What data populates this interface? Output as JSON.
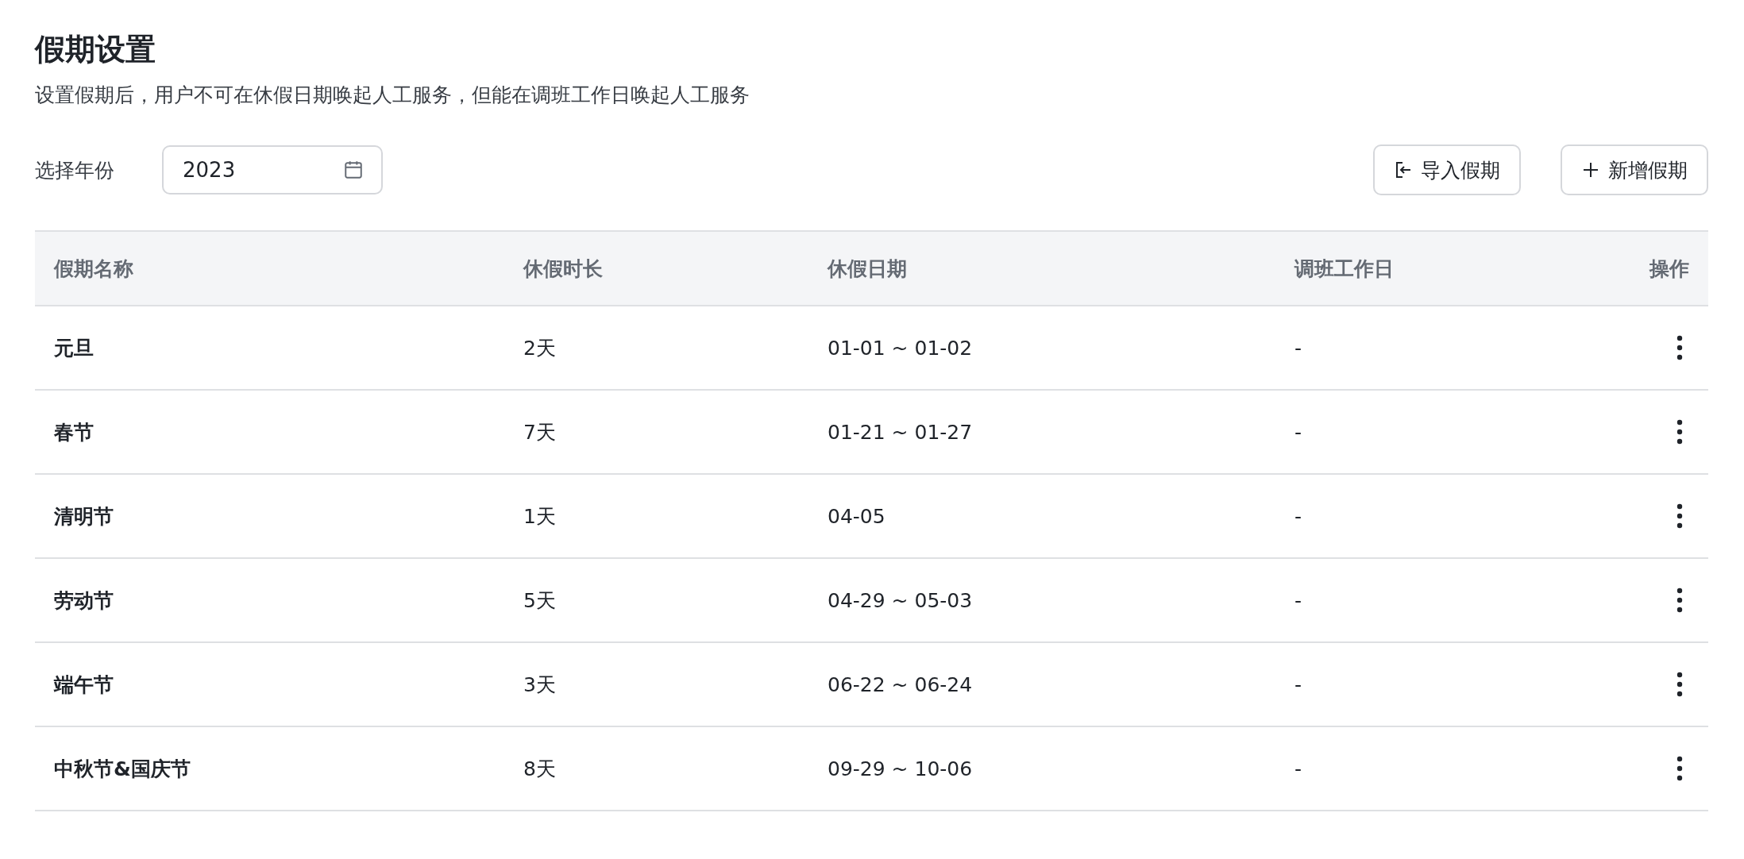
{
  "title": "假期设置",
  "description": "设置假期后，用户不可在休假日期唤起人工服务，但能在调班工作日唤起人工服务",
  "year_picker": {
    "label": "选择年份",
    "value": "2023"
  },
  "actions": [
    {
      "kind": "import",
      "label": "导入假期"
    },
    {
      "kind": "add",
      "label": "新增假期"
    }
  ],
  "table": {
    "columns": [
      "假期名称",
      "休假时长",
      "休假日期",
      "调班工作日",
      "操作"
    ],
    "rows": [
      {
        "name": "元旦",
        "duration": "2天",
        "dates": "01-01 ~ 01-02",
        "workdays": "-"
      },
      {
        "name": "春节",
        "duration": "7天",
        "dates": "01-21 ~ 01-27",
        "workdays": "-"
      },
      {
        "name": "清明节",
        "duration": "1天",
        "dates": "04-05",
        "workdays": "-"
      },
      {
        "name": "劳动节",
        "duration": "5天",
        "dates": "04-29 ~ 05-03",
        "workdays": "-"
      },
      {
        "name": "端午节",
        "duration": "3天",
        "dates": "06-22 ~ 06-24",
        "workdays": "-"
      },
      {
        "name": "中秋节&国庆节",
        "duration": "8天",
        "dates": "09-29 ~ 10-06",
        "workdays": "-"
      }
    ]
  }
}
